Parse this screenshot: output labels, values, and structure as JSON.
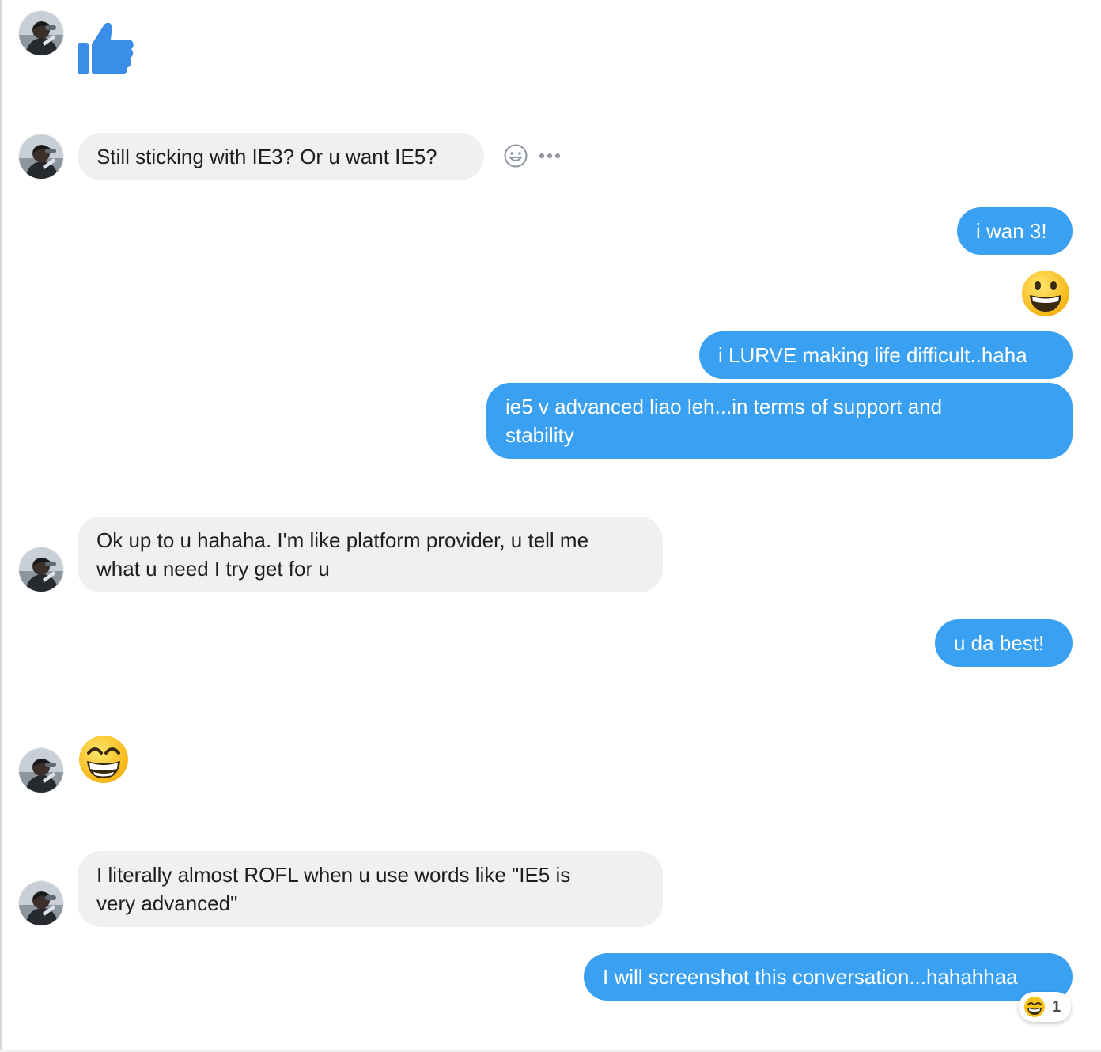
{
  "messages": [
    {
      "from": "them",
      "kind": "sticker",
      "icon": "thumbs-up-icon"
    },
    {
      "from": "them",
      "text": "Still sticking with IE3? Or u want IE5?"
    },
    {
      "from": "me",
      "text": "i wan 3!"
    },
    {
      "from": "me",
      "kind": "emoji",
      "icon": "smiley-emoji-icon"
    },
    {
      "from": "me",
      "text": "i LURVE making life difficult..haha"
    },
    {
      "from": "me",
      "text": "ie5 v advanced liao leh...in terms of support and\nstability"
    },
    {
      "from": "them",
      "text": "Ok up to u hahaha. I'm like platform provider, u tell me\nwhat u need I try get for u"
    },
    {
      "from": "me",
      "text": "u da best!"
    },
    {
      "from": "them",
      "kind": "emoji",
      "icon": "grinning-squint-emoji-icon"
    },
    {
      "from": "them",
      "text": "I literally almost ROFL when u use words like \"IE5 is\nvery advanced\""
    },
    {
      "from": "me",
      "text": "I will screenshot this conversation...hahahhaa"
    }
  ],
  "hover_actions": {
    "react_icon": "smiley-react-icon",
    "more_icon": "more-dots-icon"
  },
  "reaction": {
    "emoji_icon": "grinning-emoji-icon",
    "count": "1"
  },
  "colors": {
    "outgoing_bubble": "#3aa1f2",
    "incoming_bubble": "#f1f0f0",
    "like_blue": "#3b8ee8"
  }
}
